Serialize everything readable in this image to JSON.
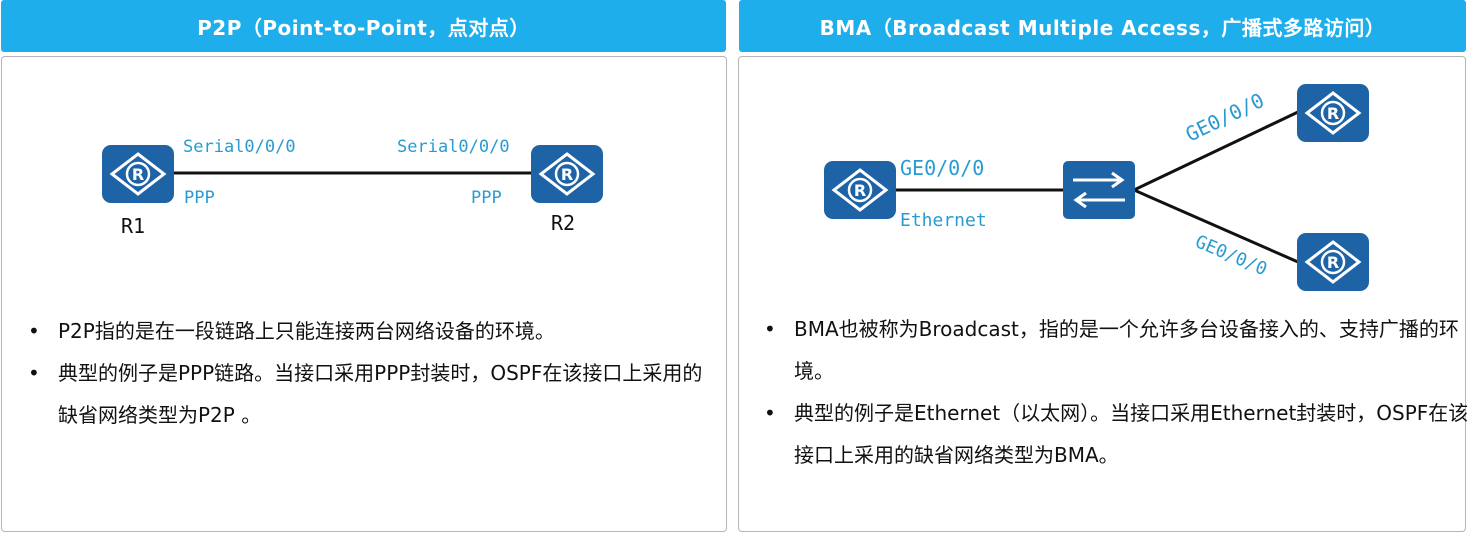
{
  "left": {
    "title": "P2P（Point-to-Point，点对点）",
    "r1_name": "R1",
    "r2_name": "R2",
    "r1_interface": "Serial0/0/0",
    "r2_interface": "Serial0/0/0",
    "r1_protocol": "PPP",
    "r2_protocol": "PPP",
    "bullets": [
      "P2P指的是在一段链路上只能连接两台网络设备的环境。",
      "典型的例子是PPP链路。当接口采用PPP封装时，OSPF在该接口上采用的缺省网络类型为P2P 。"
    ]
  },
  "right": {
    "title": "BMA（Broadcast Multiple Access，广播式多路访问）",
    "router_interface": "GE0/0/0",
    "router_protocol": "Ethernet",
    "top_link_interface": "GE0/0/0",
    "bottom_link_interface": "GE0/0/0",
    "bullets": [
      "BMA也被称为Broadcast，指的是一个允许多台设备接入的、支持广播的环境。",
      "典型的例子是Ethernet（以太网）。当接口采用Ethernet封装时，OSPF在该接口上采用的缺省网络类型为BMA。"
    ]
  },
  "colors": {
    "header_bg": "#1eaeeb",
    "device_blue": "#1e63a6",
    "label_blue": "#2a9bd1"
  },
  "icons": {
    "router": "router-icon",
    "switch": "switch-icon"
  }
}
